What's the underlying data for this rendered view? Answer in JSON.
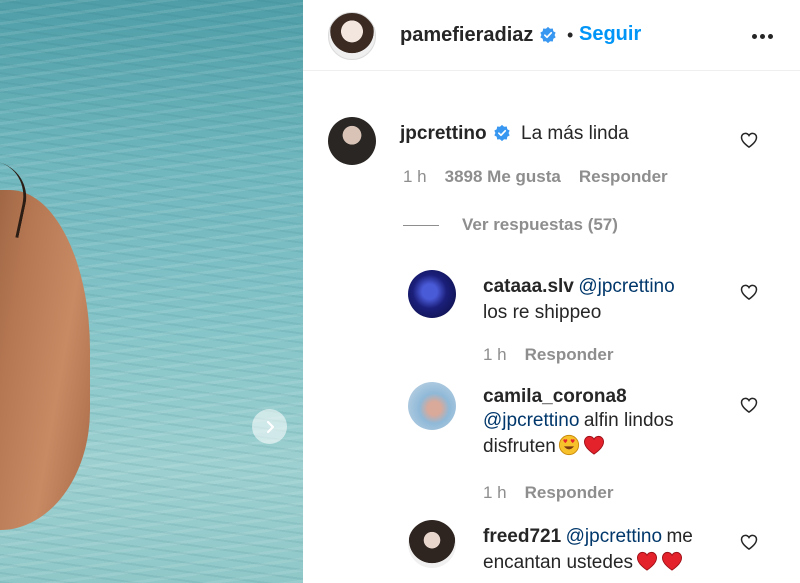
{
  "post": {
    "author": "pamefieradiaz",
    "dot": "•",
    "follow_label": "Seguir"
  },
  "comments": [
    {
      "user": "jpcrettino",
      "text": "La más linda",
      "time": "1 h",
      "likes": "3898 Me gusta",
      "reply_label": "Responder"
    }
  ],
  "view_replies_label": "Ver respuestas (57)",
  "replies": [
    {
      "user": "cataaa.slv",
      "mention": "@jpcrettino",
      "text": "los re shippeo",
      "time": "1 h",
      "reply_label": "Responder"
    },
    {
      "user": "camila_corona8",
      "mention": "@jpcrettino",
      "text": "alfin lindos disfruten",
      "time": "1 h",
      "reply_label": "Responder"
    },
    {
      "user": "freed721",
      "mention": "@jpcrettino",
      "text": "me encantan ustedes",
      "time": "",
      "reply_label": ""
    }
  ],
  "colors": {
    "link_blue": "#0095f6",
    "mention": "#00376b",
    "muted": "#8e8e8e",
    "verified": "#3897f0"
  },
  "icons": [
    "verified-badge-icon",
    "heart-outline-icon",
    "chevron-right-icon",
    "more-options-icon",
    "red-heart-emoji",
    "heart-eyes-emoji"
  ]
}
